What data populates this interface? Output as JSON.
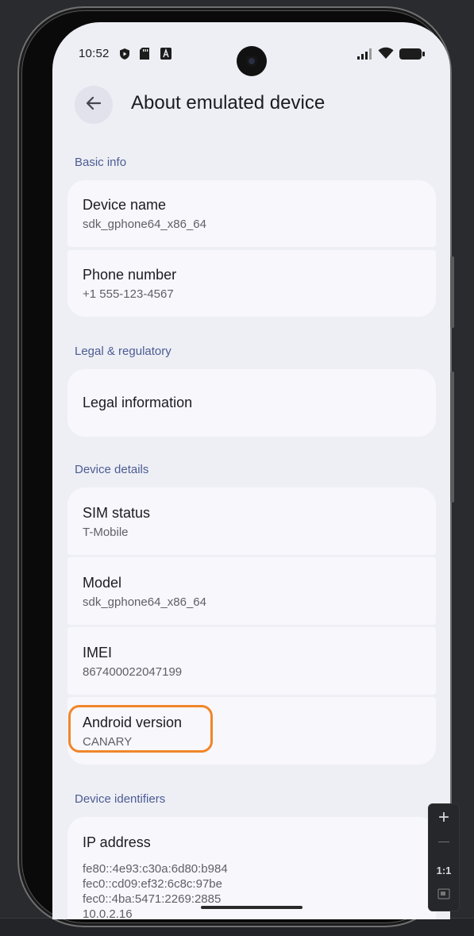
{
  "status_bar": {
    "time": "10:52",
    "left_icons": [
      "play-protect-icon",
      "sd-card-icon",
      "a-notification-icon"
    ],
    "right_icons": [
      "signal-icon",
      "wifi-icon",
      "battery-icon"
    ]
  },
  "header": {
    "title": "About emulated device",
    "back_icon": "arrow-left-icon"
  },
  "sections": {
    "basic_info": {
      "label": "Basic info",
      "items": [
        {
          "title": "Device name",
          "summary": "sdk_gphone64_x86_64"
        },
        {
          "title": "Phone number",
          "summary": "+1 555-123-4567"
        }
      ]
    },
    "legal": {
      "label": "Legal & regulatory",
      "items": [
        {
          "title": "Legal information"
        }
      ]
    },
    "device_details": {
      "label": "Device details",
      "items": [
        {
          "title": "SIM status",
          "summary": "T-Mobile"
        },
        {
          "title": "Model",
          "summary": "sdk_gphone64_x86_64"
        },
        {
          "title": "IMEI",
          "summary": "867400022047199"
        },
        {
          "title": "Android version",
          "summary": "CANARY"
        }
      ]
    },
    "device_identifiers": {
      "label": "Device identifiers",
      "items": [
        {
          "title": "IP address",
          "lines": [
            "fe80::4e93:c30a:6d80:b984",
            "fec0::cd09:ef32:6c8c:97be",
            "fec0::4ba:5471:2269:2885",
            "10.0.2.16"
          ]
        }
      ]
    }
  },
  "zoom_controls": {
    "zoom_in": "+",
    "zoom_out": "—",
    "actual_size": "1:1"
  },
  "colors": {
    "background": "#eeeff5",
    "card": "#f8f7fc",
    "section_label": "#4b5c92",
    "highlight": "#f0862a"
  }
}
